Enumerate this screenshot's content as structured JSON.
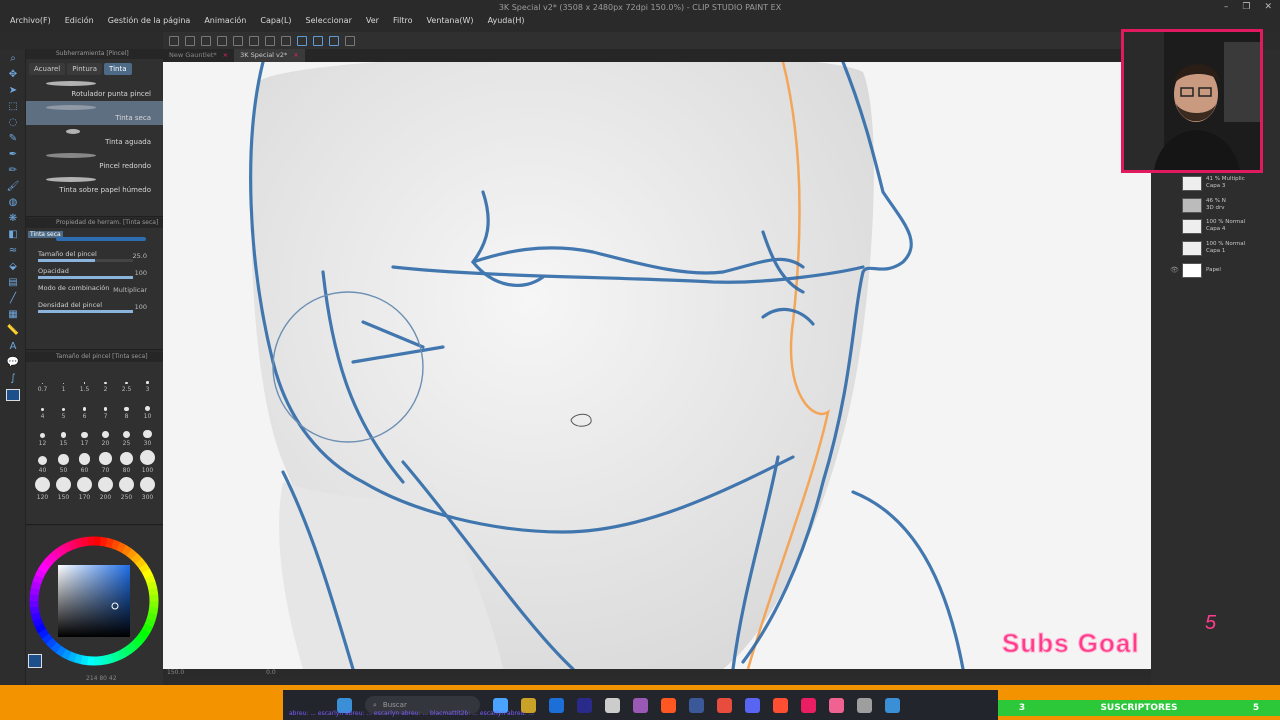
{
  "window": {
    "title": "3K Special v2* (3508 x 2480px 72dpi 150.0%) - CLIP STUDIO PAINT EX",
    "controls": [
      "–",
      "❐",
      "✕"
    ]
  },
  "menu": [
    "Archivo(F)",
    "Edición",
    "Gestión de la página",
    "Animación",
    "Capa(L)",
    "Seleccionar",
    "Ver",
    "Filtro",
    "Ventana(W)",
    "Ayuda(H)"
  ],
  "doc_tabs": [
    {
      "label": "New Gauntlet*",
      "close": "×"
    },
    {
      "label": "3K Special v2*",
      "close": "×"
    }
  ],
  "subtool_panel": {
    "title": "Subherramienta [Pincel]",
    "tabs": [
      "Acuarel",
      "Pintura",
      "Tinta"
    ],
    "brushes": [
      "Rotulador punta pincel",
      "Tinta seca",
      "Tinta aguada",
      "Pincel redondo",
      "Tinta sobre papel húmedo"
    ],
    "selected_index": 1
  },
  "tool_property": {
    "title": "Propiedad de herram. [Tinta seca]",
    "current": "Tinta seca",
    "rows": [
      {
        "name": "Tamaño del pincel",
        "value": "25.0",
        "fill": 0.6
      },
      {
        "name": "Opacidad",
        "value": "100",
        "fill": 1.0
      },
      {
        "name": "Modo de combinación",
        "value": "Multiplicar",
        "fill": 0
      },
      {
        "name": "Densidad del pincel",
        "value": "100",
        "fill": 1.0
      }
    ]
  },
  "brush_size_panel": {
    "title": "Tamaño del pincel [Tinta seca]",
    "sizes": [
      "0.7",
      "1",
      "1.5",
      "2",
      "2.5",
      "3",
      "4",
      "5",
      "6",
      "7",
      "8",
      "10",
      "12",
      "15",
      "17",
      "20",
      "25",
      "30",
      "40",
      "50",
      "60",
      "70",
      "80",
      "100",
      "120",
      "150",
      "170",
      "200",
      "250",
      "300"
    ]
  },
  "status": {
    "zoom": "150.0",
    "angle": "0.0"
  },
  "color": {
    "main": "#1d4f8a",
    "sub": "#ffffff",
    "wheel_values": "214 80 42"
  },
  "layers": [
    {
      "line1": "41 % Multiplic",
      "line2": "Capa 3"
    },
    {
      "line1": "46 % N",
      "line2": "3D drv"
    },
    {
      "line1": "100 % Normal",
      "line2": "Capa 4"
    },
    {
      "line1": "100 % Normal",
      "line2": "Capa 1"
    },
    {
      "line1": "",
      "line2": "Papel"
    }
  ],
  "taskbar": {
    "search_placeholder": "Buscar",
    "ticker": "abreu: ... escarlyn abreu: ... escarlyn abreu: ... blacmattit2b: ... escarlyn abreu: ...",
    "icon_colors": [
      "#4aa3ff",
      "#c9a227",
      "#1d6fd8",
      "#2a2a8a",
      "#cccccc",
      "#9b59b6",
      "#ff5722",
      "#3b5998",
      "#e74c3c",
      "#5865f2",
      "#ff4e32",
      "#e91e63",
      "#f06292",
      "#9e9e9e",
      "#3a8fd6"
    ]
  },
  "subs": {
    "goal_label": "Subs Goal",
    "goal_count": "5",
    "left": "3",
    "label": "SUSCRIPTORES",
    "right": "5"
  }
}
